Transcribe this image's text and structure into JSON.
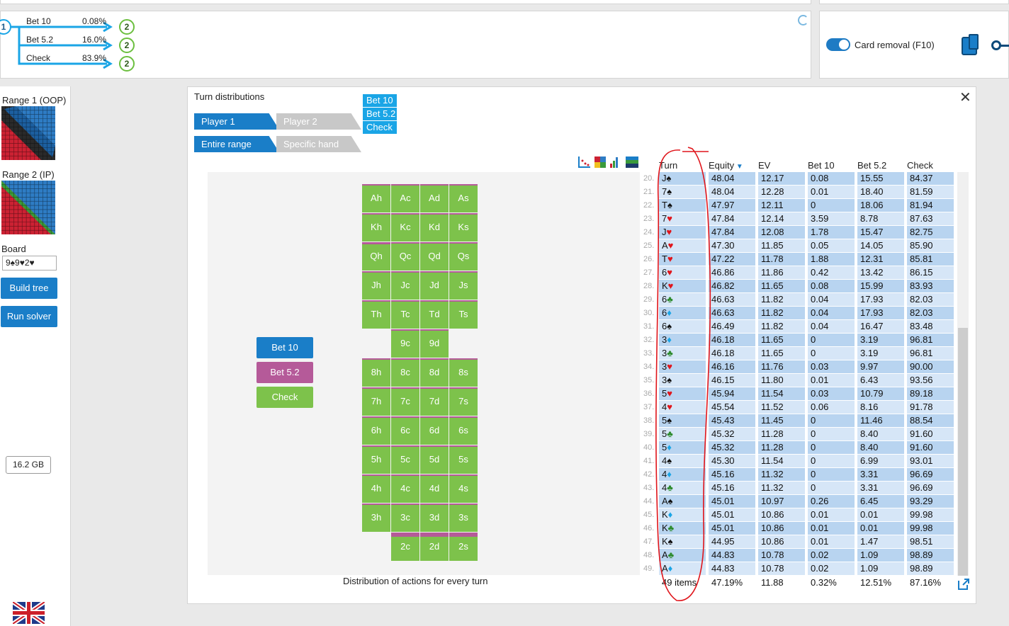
{
  "tree": {
    "root": "1",
    "child": "2",
    "actions": [
      {
        "label": "Bet 10",
        "pct": "0.08%"
      },
      {
        "label": "Bet 5.2",
        "pct": "16.0%"
      },
      {
        "label": "Check",
        "pct": "83.9%"
      }
    ]
  },
  "card_removal": "Card removal (F10)",
  "sidebar": {
    "range1": "Range 1 (OOP)",
    "range2": "Range 2 (IP)",
    "board_label": "Board",
    "board_value": "9♠9♥2♥",
    "build_tree": "Build tree",
    "run_solver": "Run solver",
    "memory": "16.2 GB"
  },
  "dialog": {
    "title": "Turn distributions",
    "player_tabs": [
      "Player 1",
      "Player 2"
    ],
    "range_tabs": [
      "Entire range",
      "Specific hand"
    ],
    "legend_tags": [
      "Bet 10",
      "Bet 5.2",
      "Check"
    ],
    "legend_buttons": [
      "Bet 10",
      "Bet 5.2",
      "Check"
    ],
    "caption": "Distribution of actions for every turn"
  },
  "colors": {
    "bet10": "#1a7ec8",
    "bet52": "#b55a99",
    "check": "#7dc24b"
  },
  "cards": [
    {
      "r": 0,
      "items": [
        {
          "c": 1,
          "label": "Ah",
          "p": 0.12
        },
        {
          "c": 2,
          "label": "Ac",
          "p": 0.1
        },
        {
          "c": 3,
          "label": "Ad",
          "p": 0.1
        },
        {
          "c": 4,
          "label": "As",
          "p": 0.1
        }
      ]
    },
    {
      "r": 1,
      "items": [
        {
          "c": 1,
          "label": "Kh",
          "p": 0.15
        },
        {
          "c": 2,
          "label": "Kc",
          "p": 0.05
        },
        {
          "c": 3,
          "label": "Kd",
          "p": 0.05
        },
        {
          "c": 4,
          "label": "Ks",
          "p": 0.05
        }
      ]
    },
    {
      "r": 2,
      "items": [
        {
          "c": 1,
          "label": "Qh",
          "p": 0.18
        },
        {
          "c": 2,
          "label": "Qc",
          "p": 0.15
        },
        {
          "c": 3,
          "label": "Qd",
          "p": 0.15
        },
        {
          "c": 4,
          "label": "Qs",
          "p": 0.15
        }
      ]
    },
    {
      "r": 3,
      "items": [
        {
          "c": 1,
          "label": "Jh",
          "p": 0.15
        },
        {
          "c": 2,
          "label": "Jc",
          "p": 0.15
        },
        {
          "c": 3,
          "label": "Jd",
          "p": 0.15
        },
        {
          "c": 4,
          "label": "Js",
          "p": 0.15
        }
      ]
    },
    {
      "r": 4,
      "items": [
        {
          "c": 1,
          "label": "Th",
          "p": 0.12
        },
        {
          "c": 2,
          "label": "Tc",
          "p": 0.15
        },
        {
          "c": 3,
          "label": "Td",
          "p": 0.15
        },
        {
          "c": 4,
          "label": "Ts",
          "p": 0.15
        }
      ]
    },
    {
      "r": 5,
      "items": [
        {
          "c": 2,
          "label": "9c",
          "p": 0.15
        },
        {
          "c": 3,
          "label": "9d",
          "p": 0.15
        }
      ]
    },
    {
      "r": 6,
      "items": [
        {
          "c": 1,
          "label": "8h",
          "p": 0.15
        },
        {
          "c": 2,
          "label": "8c",
          "p": 0.15
        },
        {
          "c": 3,
          "label": "8d",
          "p": 0.15
        },
        {
          "c": 4,
          "label": "8s",
          "p": 0.15
        }
      ]
    },
    {
      "r": 7,
      "items": [
        {
          "c": 1,
          "label": "7h",
          "p": 0.15
        },
        {
          "c": 2,
          "label": "7c",
          "p": 0.15
        },
        {
          "c": 3,
          "label": "7d",
          "p": 0.15
        },
        {
          "c": 4,
          "label": "7s",
          "p": 0.15
        }
      ]
    },
    {
      "r": 8,
      "items": [
        {
          "c": 1,
          "label": "6h",
          "p": 0.1
        },
        {
          "c": 2,
          "label": "6c",
          "p": 0.1
        },
        {
          "c": 3,
          "label": "6d",
          "p": 0.1
        },
        {
          "c": 4,
          "label": "6s",
          "p": 0.1
        }
      ]
    },
    {
      "r": 9,
      "items": [
        {
          "c": 1,
          "label": "5h",
          "p": 0.1
        },
        {
          "c": 2,
          "label": "5c",
          "p": 0.1
        },
        {
          "c": 3,
          "label": "5d",
          "p": 0.1
        },
        {
          "c": 4,
          "label": "5s",
          "p": 0.1
        }
      ]
    },
    {
      "r": 10,
      "items": [
        {
          "c": 1,
          "label": "4h",
          "p": 0.1
        },
        {
          "c": 2,
          "label": "4c",
          "p": 0.1
        },
        {
          "c": 3,
          "label": "4d",
          "p": 0.1
        },
        {
          "c": 4,
          "label": "4s",
          "p": 0.1
        }
      ]
    },
    {
      "r": 11,
      "items": [
        {
          "c": 1,
          "label": "3h",
          "p": 0.1
        },
        {
          "c": 2,
          "label": "3c",
          "p": 0.1
        },
        {
          "c": 3,
          "label": "3d",
          "p": 0.1
        },
        {
          "c": 4,
          "label": "3s",
          "p": 0.1
        }
      ]
    },
    {
      "r": 12,
      "items": [
        {
          "c": 2,
          "label": "2c",
          "p": 0.35
        },
        {
          "c": 3,
          "label": "2d",
          "p": 0.35
        },
        {
          "c": 4,
          "label": "2s",
          "p": 0.35
        }
      ]
    }
  ],
  "table": {
    "headers": [
      "Turn",
      "Equity",
      "EV",
      "Bet 10",
      "Bet 5.2",
      "Check"
    ],
    "rows": [
      [
        "20.",
        "J",
        "♠",
        "48.04",
        "12.17",
        "0.08",
        "15.55",
        "84.37"
      ],
      [
        "21.",
        "7",
        "♠",
        "48.04",
        "12.28",
        "0.01",
        "18.40",
        "81.59"
      ],
      [
        "22.",
        "T",
        "♠",
        "47.97",
        "12.11",
        "0",
        "18.06",
        "81.94"
      ],
      [
        "23.",
        "7",
        "♥",
        "47.84",
        "12.14",
        "3.59",
        "8.78",
        "87.63"
      ],
      [
        "24.",
        "J",
        "♥",
        "47.84",
        "12.08",
        "1.78",
        "15.47",
        "82.75"
      ],
      [
        "25.",
        "A",
        "♥",
        "47.30",
        "11.85",
        "0.05",
        "14.05",
        "85.90"
      ],
      [
        "26.",
        "T",
        "♥",
        "47.22",
        "11.78",
        "1.88",
        "12.31",
        "85.81"
      ],
      [
        "27.",
        "6",
        "♥",
        "46.86",
        "11.86",
        "0.42",
        "13.42",
        "86.15"
      ],
      [
        "28.",
        "K",
        "♥",
        "46.82",
        "11.65",
        "0.08",
        "15.99",
        "83.93"
      ],
      [
        "29.",
        "6",
        "♣",
        "46.63",
        "11.82",
        "0.04",
        "17.93",
        "82.03"
      ],
      [
        "30.",
        "6",
        "♦",
        "46.63",
        "11.82",
        "0.04",
        "17.93",
        "82.03"
      ],
      [
        "31.",
        "6",
        "♠",
        "46.49",
        "11.82",
        "0.04",
        "16.47",
        "83.48"
      ],
      [
        "32.",
        "3",
        "♦",
        "46.18",
        "11.65",
        "0",
        "3.19",
        "96.81"
      ],
      [
        "33.",
        "3",
        "♣",
        "46.18",
        "11.65",
        "0",
        "3.19",
        "96.81"
      ],
      [
        "34.",
        "3",
        "♥",
        "46.16",
        "11.76",
        "0.03",
        "9.97",
        "90.00"
      ],
      [
        "35.",
        "3",
        "♠",
        "46.15",
        "11.80",
        "0.01",
        "6.43",
        "93.56"
      ],
      [
        "36.",
        "5",
        "♥",
        "45.94",
        "11.54",
        "0.03",
        "10.79",
        "89.18"
      ],
      [
        "37.",
        "4",
        "♥",
        "45.54",
        "11.52",
        "0.06",
        "8.16",
        "91.78"
      ],
      [
        "38.",
        "5",
        "♠",
        "45.43",
        "11.45",
        "0",
        "11.46",
        "88.54"
      ],
      [
        "39.",
        "5",
        "♣",
        "45.32",
        "11.28",
        "0",
        "8.40",
        "91.60"
      ],
      [
        "40.",
        "5",
        "♦",
        "45.32",
        "11.28",
        "0",
        "8.40",
        "91.60"
      ],
      [
        "41.",
        "4",
        "♠",
        "45.30",
        "11.54",
        "0",
        "6.99",
        "93.01"
      ],
      [
        "42.",
        "4",
        "♦",
        "45.16",
        "11.32",
        "0",
        "3.31",
        "96.69"
      ],
      [
        "43.",
        "4",
        "♣",
        "45.16",
        "11.32",
        "0",
        "3.31",
        "96.69"
      ],
      [
        "44.",
        "A",
        "♠",
        "45.01",
        "10.97",
        "0.26",
        "6.45",
        "93.29"
      ],
      [
        "45.",
        "K",
        "♦",
        "45.01",
        "10.86",
        "0.01",
        "0.01",
        "99.98"
      ],
      [
        "46.",
        "K",
        "♣",
        "45.01",
        "10.86",
        "0.01",
        "0.01",
        "99.98"
      ],
      [
        "47.",
        "K",
        "♠",
        "44.95",
        "10.86",
        "0.01",
        "1.47",
        "98.51"
      ],
      [
        "48.",
        "A",
        "♣",
        "44.83",
        "10.78",
        "0.02",
        "1.09",
        "98.89"
      ],
      [
        "49.",
        "A",
        "♦",
        "44.83",
        "10.78",
        "0.02",
        "1.09",
        "98.89"
      ]
    ],
    "footer": [
      "49 items",
      "47.19%",
      "11.88",
      "0.32%",
      "12.51%",
      "87.16%"
    ]
  }
}
